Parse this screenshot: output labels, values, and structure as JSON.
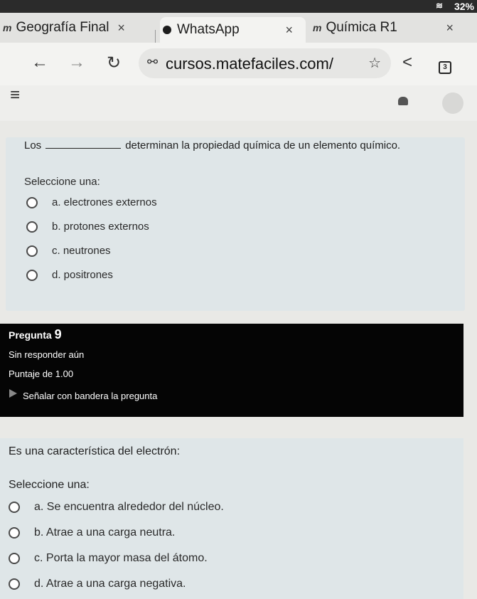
{
  "status": {
    "battery": "32%",
    "wifi_icon": "wifi-icon"
  },
  "tabs": [
    {
      "label": "Geografía Final",
      "close": "×"
    },
    {
      "label": "WhatsApp",
      "close": "×"
    },
    {
      "label": "Química R1",
      "close": "×"
    }
  ],
  "toolbar": {
    "url": "cursos.matefaciles.com/",
    "tab_count": "3"
  },
  "question1": {
    "text_before": "Los",
    "text_after": "determinan la propiedad química de un elemento químico.",
    "prompt": "Seleccione una:",
    "options": [
      "a. electrones externos",
      "b. protones externos",
      "c. neutrones",
      "d. positrones"
    ]
  },
  "question_info": {
    "title": "Pregunta",
    "number": "9",
    "status": "Sin responder aún",
    "score": "Puntaje de 1.00",
    "flag_label": "Señalar con bandera la pregunta"
  },
  "question2": {
    "text": "Es una característica del electrón:",
    "prompt": "Seleccione una:",
    "options": [
      "a. Se encuentra alrededor del núcleo.",
      "b. Atrae a una carga neutra.",
      "c. Porta la mayor masa del átomo.",
      "d. Atrae a una carga negativa."
    ]
  }
}
